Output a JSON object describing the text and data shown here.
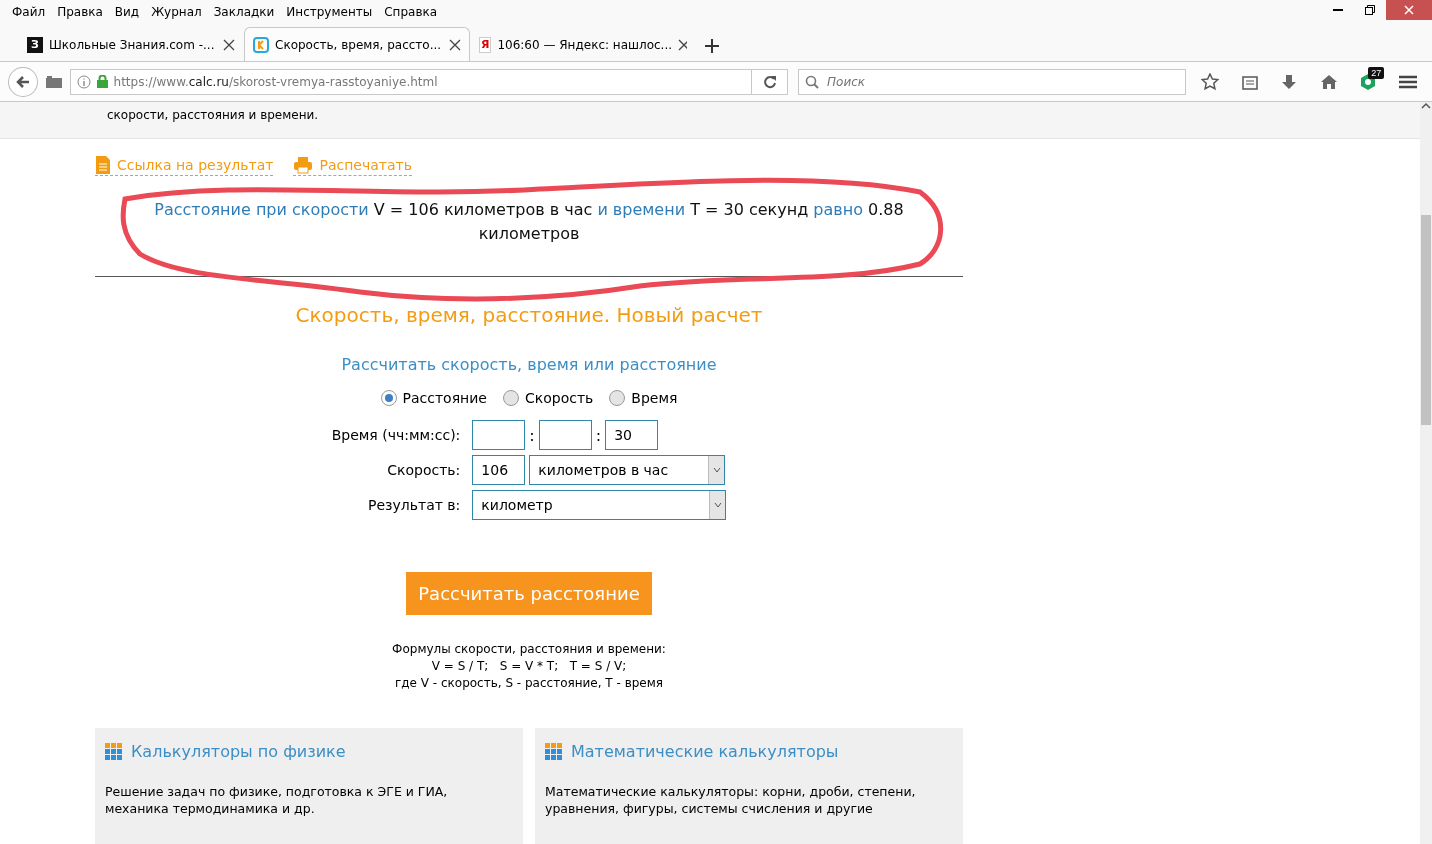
{
  "menu": [
    "Файл",
    "Правка",
    "Вид",
    "Журнал",
    "Закладки",
    "Инструменты",
    "Справка"
  ],
  "tabs": [
    {
      "title": "Школьные Знания.com -...",
      "favicon": "З",
      "kind": "znanija",
      "selected": false
    },
    {
      "title": "Скорость, время, рассто...",
      "kind": "calc",
      "selected": true
    },
    {
      "title": "106:60 — Яндекс: нашлос...",
      "favicon": "Я",
      "kind": "yandex",
      "selected": false
    }
  ],
  "address": {
    "url_prefix": "https://www.",
    "url_domain": "calc.ru",
    "url_path": "/skorost-vremya-rasstoyaniye.html"
  },
  "search": {
    "placeholder": "Поиск"
  },
  "extension_badge": "27",
  "intro_tail": "скорости, расстояния и времени.",
  "actions": [
    "Ссылка на результат",
    "Распечатать"
  ],
  "result": [
    {
      "text": "Расстояние при скорости",
      "kind": "term"
    },
    {
      "text": " V = 106 километров в час ",
      "kind": "value"
    },
    {
      "text": "и времени",
      "kind": "term"
    },
    {
      "text": " T = 30 секунд ",
      "kind": "value"
    },
    {
      "text": "равно",
      "kind": "term"
    },
    {
      "text": " 0.88 километров",
      "kind": "value"
    }
  ],
  "heading": "Скорость, время, расстояние. Новый расчет",
  "subheading": "Рассчитать скорость, время или расстояние",
  "modes": [
    {
      "label": "Расстояние",
      "selected": true
    },
    {
      "label": "Скорость",
      "selected": false
    },
    {
      "label": "Время",
      "selected": false
    }
  ],
  "form": {
    "time_label": "Время (чч:мм:сс):",
    "time_sep": ":",
    "seconds": "30",
    "speed_label": "Скорость:",
    "speed": "106",
    "speed_unit": "километров в час",
    "result_label": "Результат в:",
    "result_unit": "километр"
  },
  "submit": "Рассчитать расстояние",
  "formulas": [
    "Формулы скорости, расстояния и времени:",
    "V = S / T;   S = V * T;   T = S / V;",
    "где V - скорость, S - расстояние, T - время"
  ],
  "cards": [
    {
      "title": "Калькуляторы по физике",
      "text": "Решение задач по физике, подготовка к ЭГЕ и ГИА, механика термодинамика и др."
    },
    {
      "title": "Математические калькуляторы",
      "text": "Математические калькуляторы: корни, дроби, степени, уравнения, фигуры, системы счисления и другие"
    }
  ]
}
